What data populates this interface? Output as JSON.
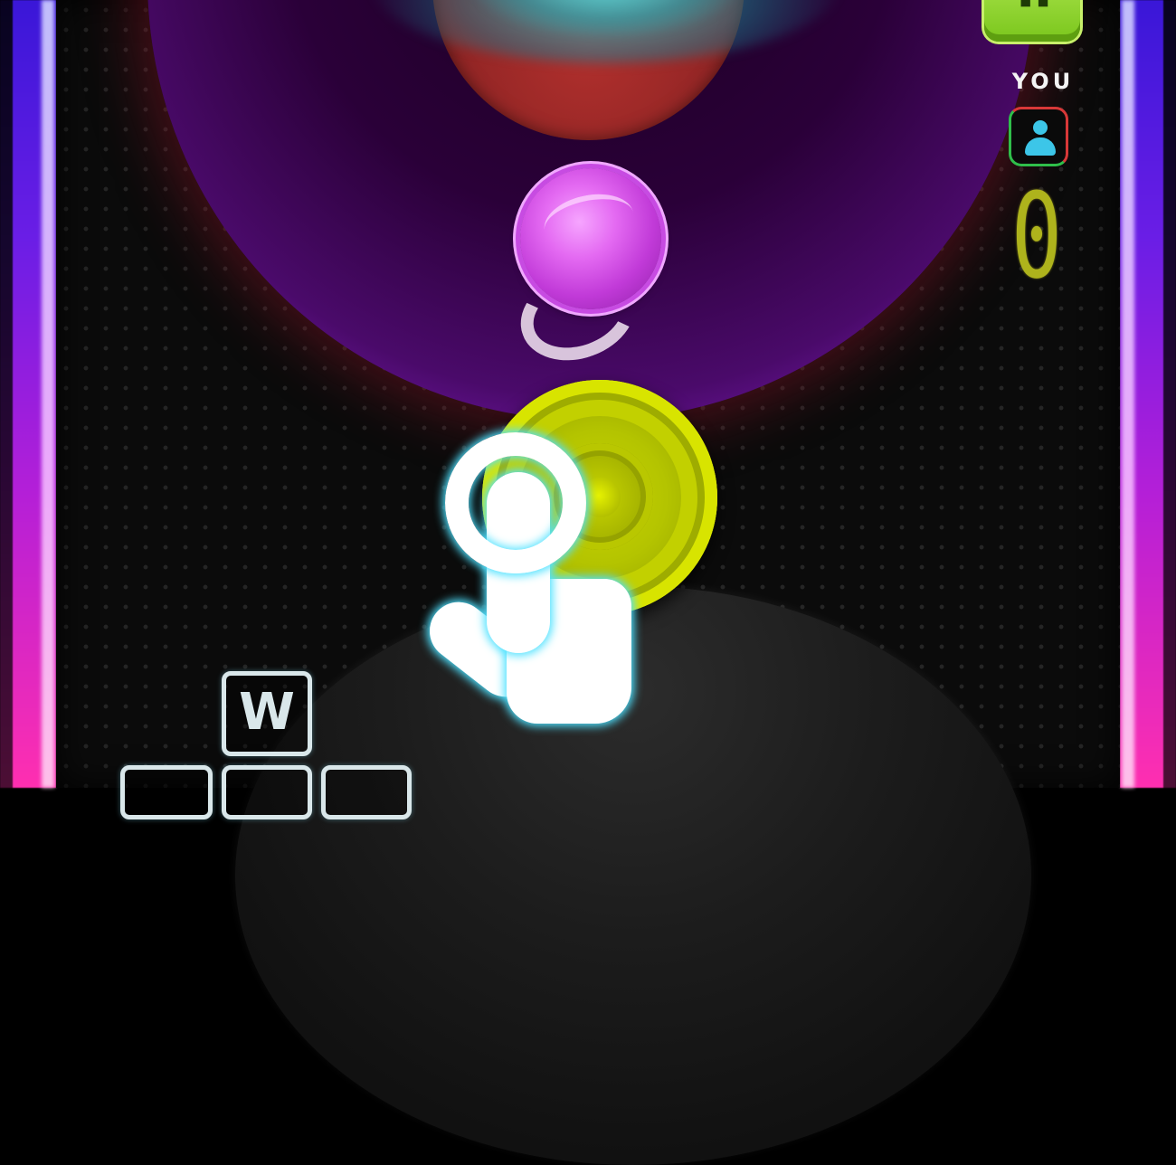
{
  "game": {
    "hud": {
      "player_label": "YOU",
      "player_score": "0",
      "opponent_avatar_icon": "opponent-face-icon",
      "player_avatar_icon": "user-icon"
    },
    "controls_hint": {
      "up_key": "W"
    },
    "tutorial": {
      "gesture_icon": "tap-hand-icon"
    },
    "colors": {
      "puck": "#c13ad8",
      "player_paddle": "#b4c400",
      "opponent_paddle": "#8e2424",
      "rail_top": "#3a17d8",
      "rail_bottom": "#ff2fb0",
      "score": "#aeb31c"
    }
  }
}
